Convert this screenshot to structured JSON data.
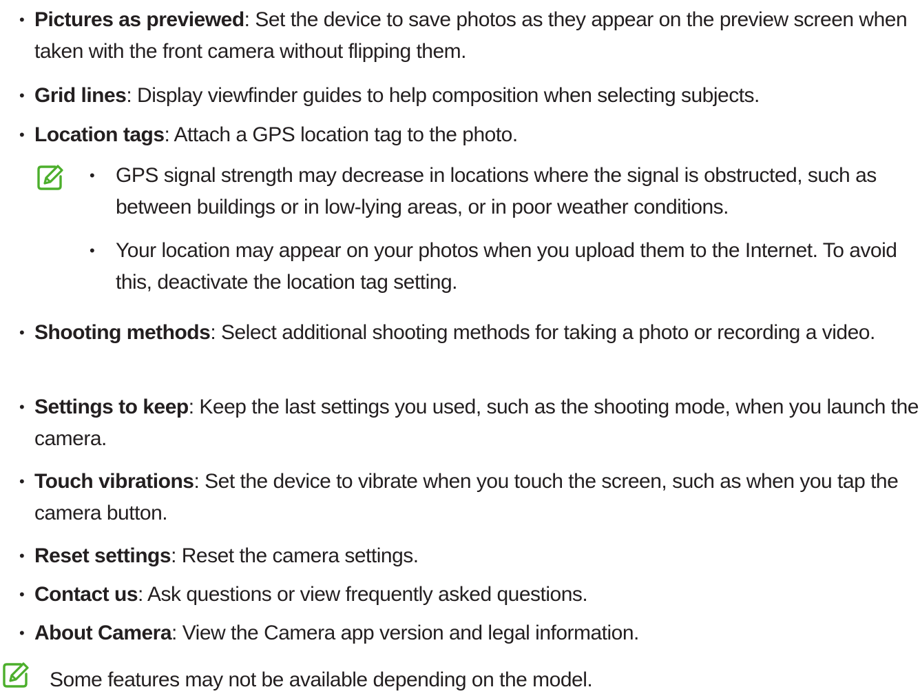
{
  "items": [
    {
      "term": "Pictures as previewed",
      "desc": ": Set the device to save photos as they appear on the preview screen when taken with the front camera without flipping them."
    },
    {
      "term": "Grid lines",
      "desc": ": Display viewfinder guides to help composition when selecting subjects."
    },
    {
      "term": "Location tags",
      "desc": ": Attach a GPS location tag to the photo."
    },
    {
      "term": "Shooting methods",
      "desc": ": Select additional shooting methods for taking a photo or recording a video."
    },
    {
      "term": "Settings to keep",
      "desc": ": Keep the last settings you used, such as the shooting mode, when you launch the camera."
    },
    {
      "term": "Touch vibrations",
      "desc": ": Set the device to vibrate when you touch the screen, such as when you tap the camera button."
    },
    {
      "term": "Reset settings",
      "desc": ": Reset the camera settings."
    },
    {
      "term": "Contact us",
      "desc": ": Ask questions or view frequently asked questions."
    },
    {
      "term": "About Camera",
      "desc": ": View the Camera app version and legal information."
    }
  ],
  "location_notes": [
    "GPS signal strength may decrease in locations where the signal is obstructed, such as between buildings or in low-lying areas, or in poor weather conditions.",
    "Your location may appear on your photos when you upload them to the Internet. To avoid this, deactivate the location tag setting."
  ],
  "final_note": "Some features may not be available depending on the model.",
  "bullet_glyph": "•",
  "icons": {
    "note": "note-pencil-icon"
  },
  "colors": {
    "text": "#231f20",
    "note_icon": "#4caf2c"
  }
}
